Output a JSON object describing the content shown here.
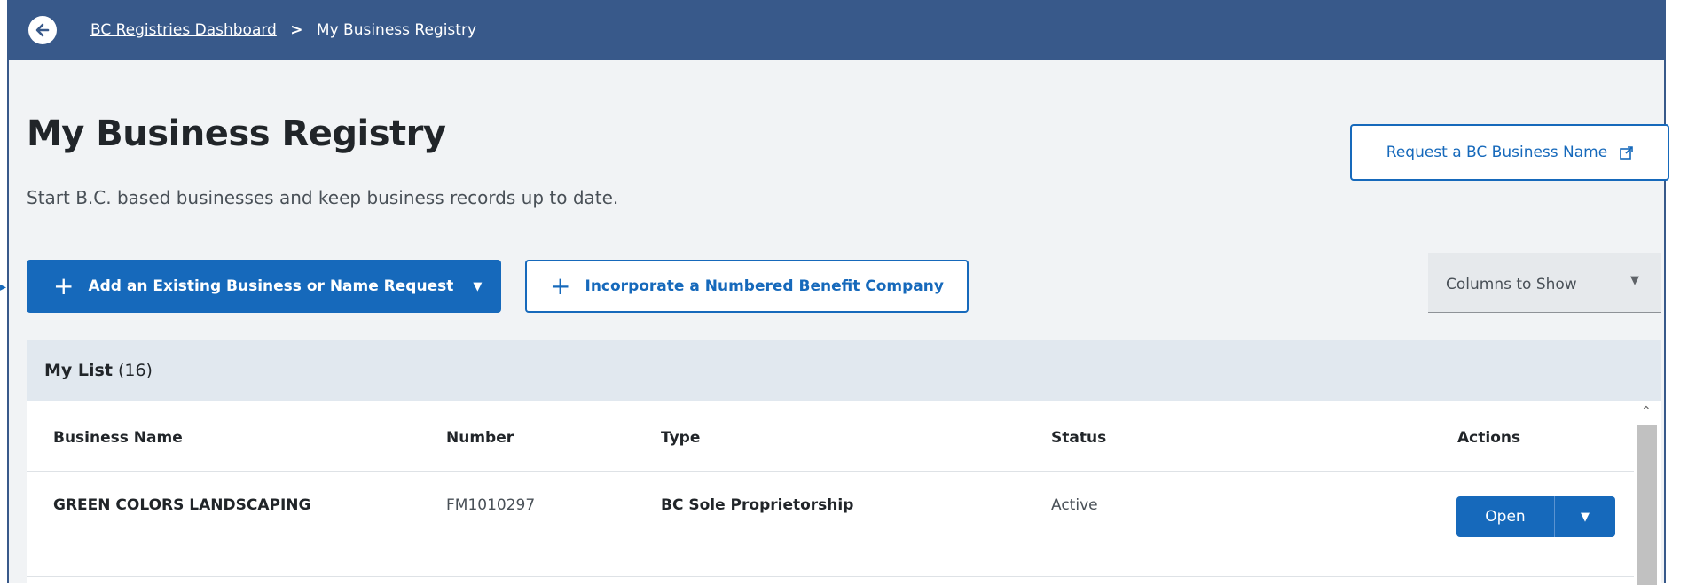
{
  "breadcrumb": {
    "items": [
      "BC Registries Dashboard",
      "My Business Registry"
    ],
    "separator": ">"
  },
  "page": {
    "title": "My Business Registry",
    "subtitle": "Start B.C. based businesses and keep business records up to date."
  },
  "buttons": {
    "request_name": "Request a BC Business Name",
    "add_existing": "Add an Existing Business or Name Request",
    "incorporate": "Incorporate a Numbered Benefit Company",
    "columns_to_show": "Columns to Show"
  },
  "list": {
    "title": "My List",
    "count": "(16)",
    "columns": [
      "Business Name",
      "Number",
      "Type",
      "Status",
      "Actions"
    ],
    "rows": [
      {
        "name": "GREEN COLORS LANDSCAPING",
        "number": "FM1010297",
        "type": "BC Sole Proprietorship",
        "status": "Active",
        "action": "Open"
      }
    ]
  },
  "icons": {
    "back": "arrow-left-circle-icon",
    "external": "external-link-icon",
    "plus": "plus-icon",
    "caret": "caret-down-icon"
  },
  "colors": {
    "header_bg": "#38598a",
    "primary": "#1669bb",
    "page_bg": "#f1f3f5",
    "list_header_bg": "#e1e8ef"
  }
}
